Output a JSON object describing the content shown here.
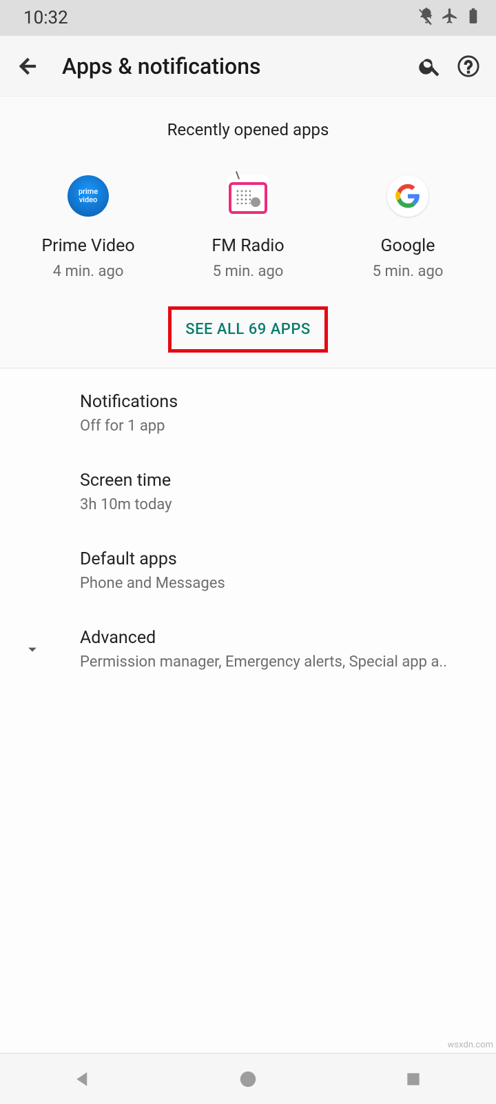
{
  "statusbar": {
    "time": "10:32"
  },
  "appbar": {
    "title": "Apps & notifications"
  },
  "recent": {
    "header": "Recently opened apps",
    "apps": [
      {
        "name": "Prime Video",
        "time": "4 min. ago"
      },
      {
        "name": "FM Radio",
        "time": "5 min. ago"
      },
      {
        "name": "Google",
        "time": "5 min. ago"
      }
    ],
    "see_all": "SEE ALL 69 APPS"
  },
  "settings": [
    {
      "title": "Notifications",
      "sub": "Off for 1 app"
    },
    {
      "title": "Screen time",
      "sub": "3h 10m today"
    },
    {
      "title": "Default apps",
      "sub": "Phone and Messages"
    },
    {
      "title": "Advanced",
      "sub": "Permission manager, Emergency alerts, Special app a.."
    }
  ],
  "watermark": "wsxdn.com"
}
